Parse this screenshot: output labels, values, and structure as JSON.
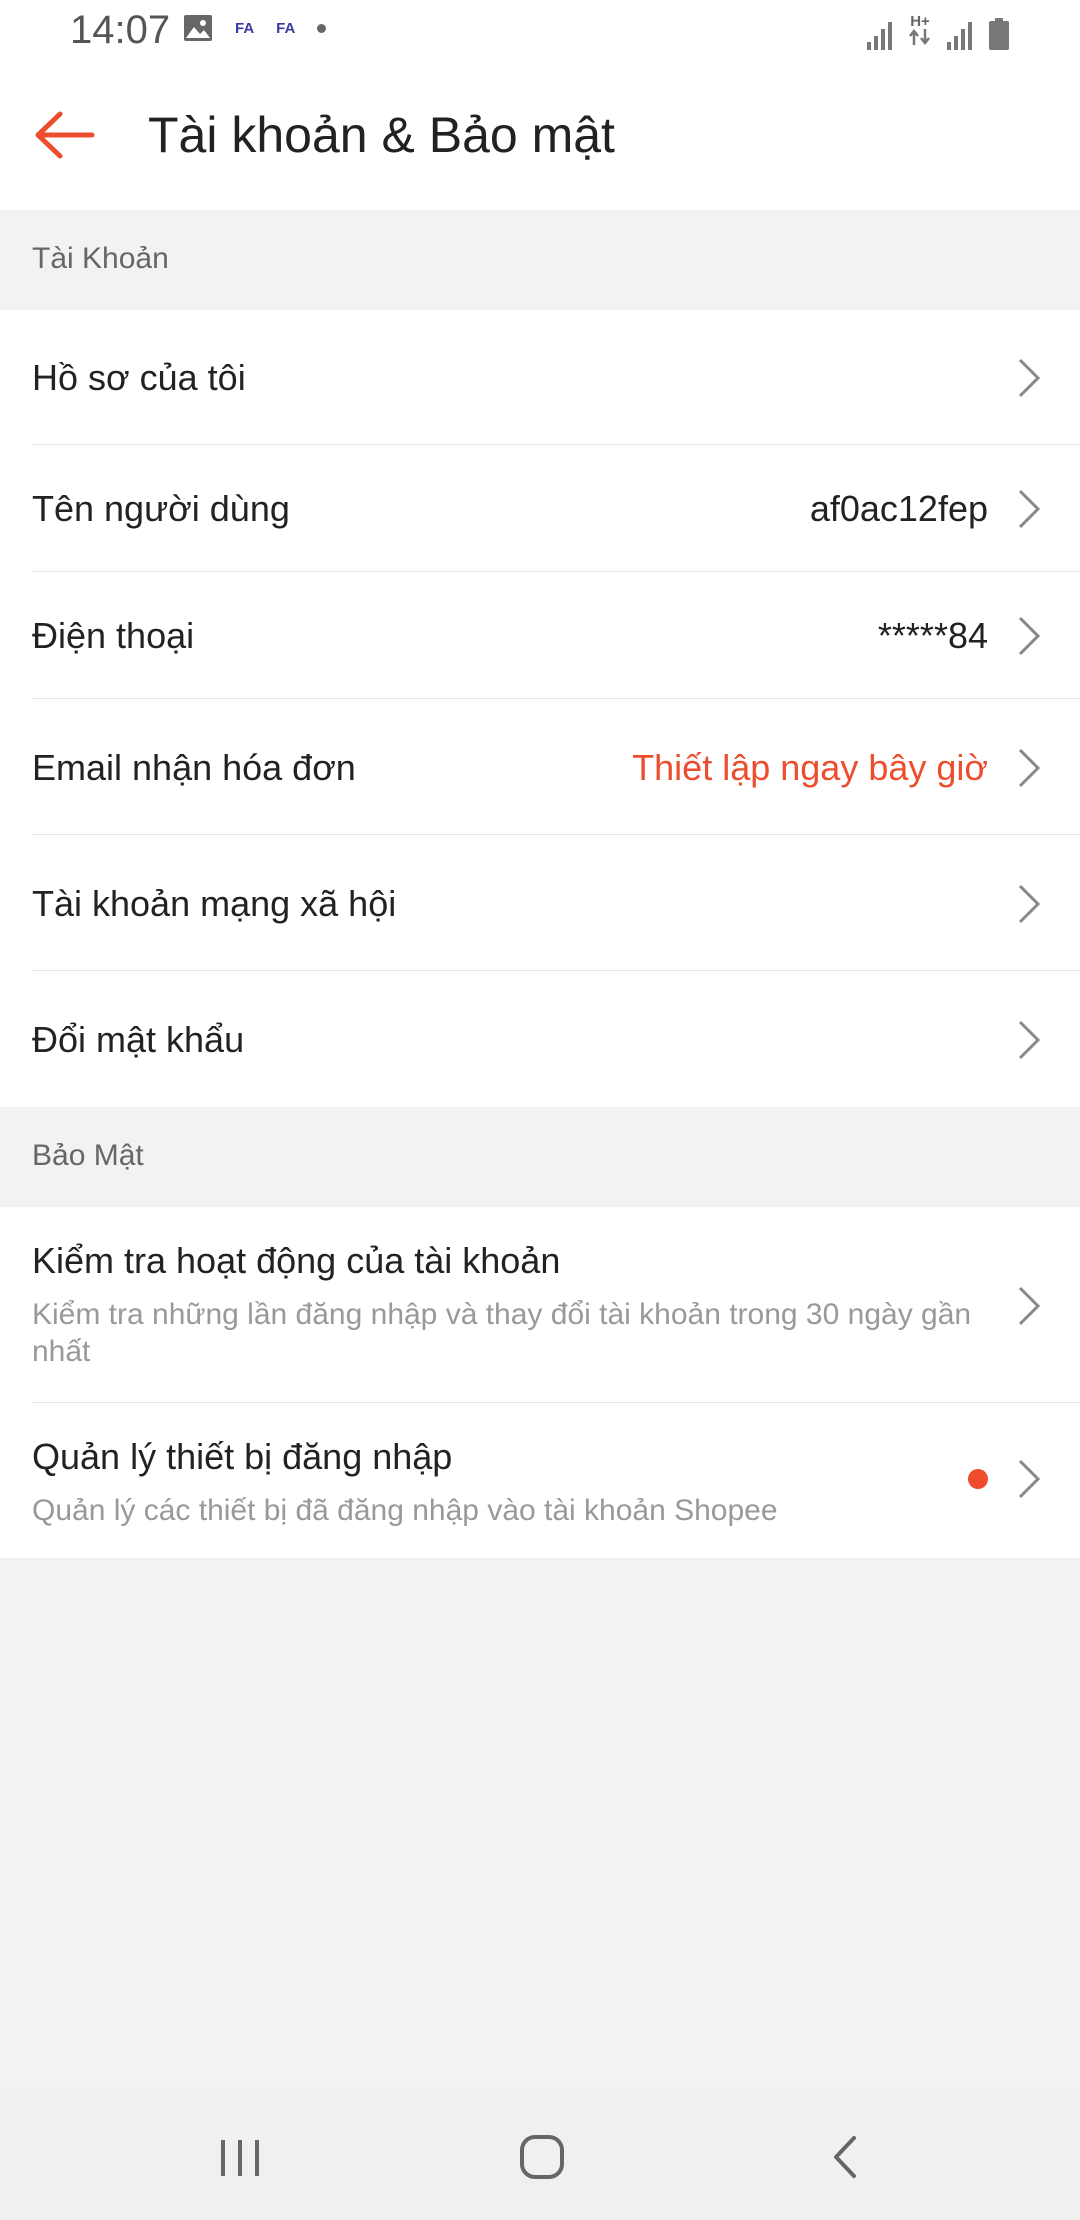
{
  "status_bar": {
    "time": "14:07",
    "badge1": "FA",
    "badge2": "FA",
    "network": "H+"
  },
  "header": {
    "title": "Tài khoản & Bảo mật",
    "back_icon": "arrow-left-icon"
  },
  "account_section": {
    "title": "Tài Khoản",
    "items": [
      {
        "label": "Hồ sơ của tôi",
        "value": ""
      },
      {
        "label": "Tên người dùng",
        "value": "af0ac12fep"
      },
      {
        "label": "Điện thoại",
        "value": "*****84"
      },
      {
        "label": "Email nhận hóa đơn",
        "value": "Thiết lập ngay bây giờ"
      },
      {
        "label": "Tài khoản mạng xã hội",
        "value": ""
      },
      {
        "label": "Đổi mật khẩu",
        "value": ""
      }
    ]
  },
  "security_section": {
    "title": "Bảo Mật",
    "items": [
      {
        "label": "Kiểm tra hoạt động của tài khoản",
        "description": "Kiểm tra những lần đăng nhập và thay đổi tài khoản trong 30 ngày gần nhất"
      },
      {
        "label": "Quản lý thiết bị đăng nhập",
        "description": "Quản lý các thiết bị đã đăng nhập vào tài khoản Shopee"
      }
    ]
  },
  "colors": {
    "accent": "#ee4d2d",
    "background": "#f2f2f2",
    "surface": "#ffffff",
    "secondary_text": "#999999"
  },
  "nav_bar": {
    "icons": [
      "recent-apps-icon",
      "home-icon",
      "back-icon"
    ]
  }
}
